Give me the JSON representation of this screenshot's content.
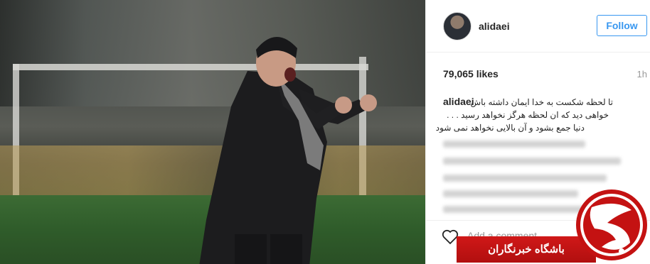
{
  "header": {
    "username": "alidaei",
    "follow_label": "Follow"
  },
  "post": {
    "likes": "79,065 likes",
    "time": "1h",
    "caption": {
      "username": "alidaei",
      "lines": [
        "تا لحظه شکست به خدا ایمان داشته باش",
        "خواهی دید که ان لحظه هرگز نخواهد رسید . . .",
        "دنیا جمع بشود و آن بالایی نخواهد نمی شود"
      ]
    }
  },
  "actions": {
    "like_icon": "heart-icon",
    "comment_placeholder": "Add a comment..."
  },
  "watermark": {
    "text": "باشگاه خبرنگاران"
  },
  "colors": {
    "link_blue": "#3897f0",
    "watermark_red": "#c41212"
  }
}
